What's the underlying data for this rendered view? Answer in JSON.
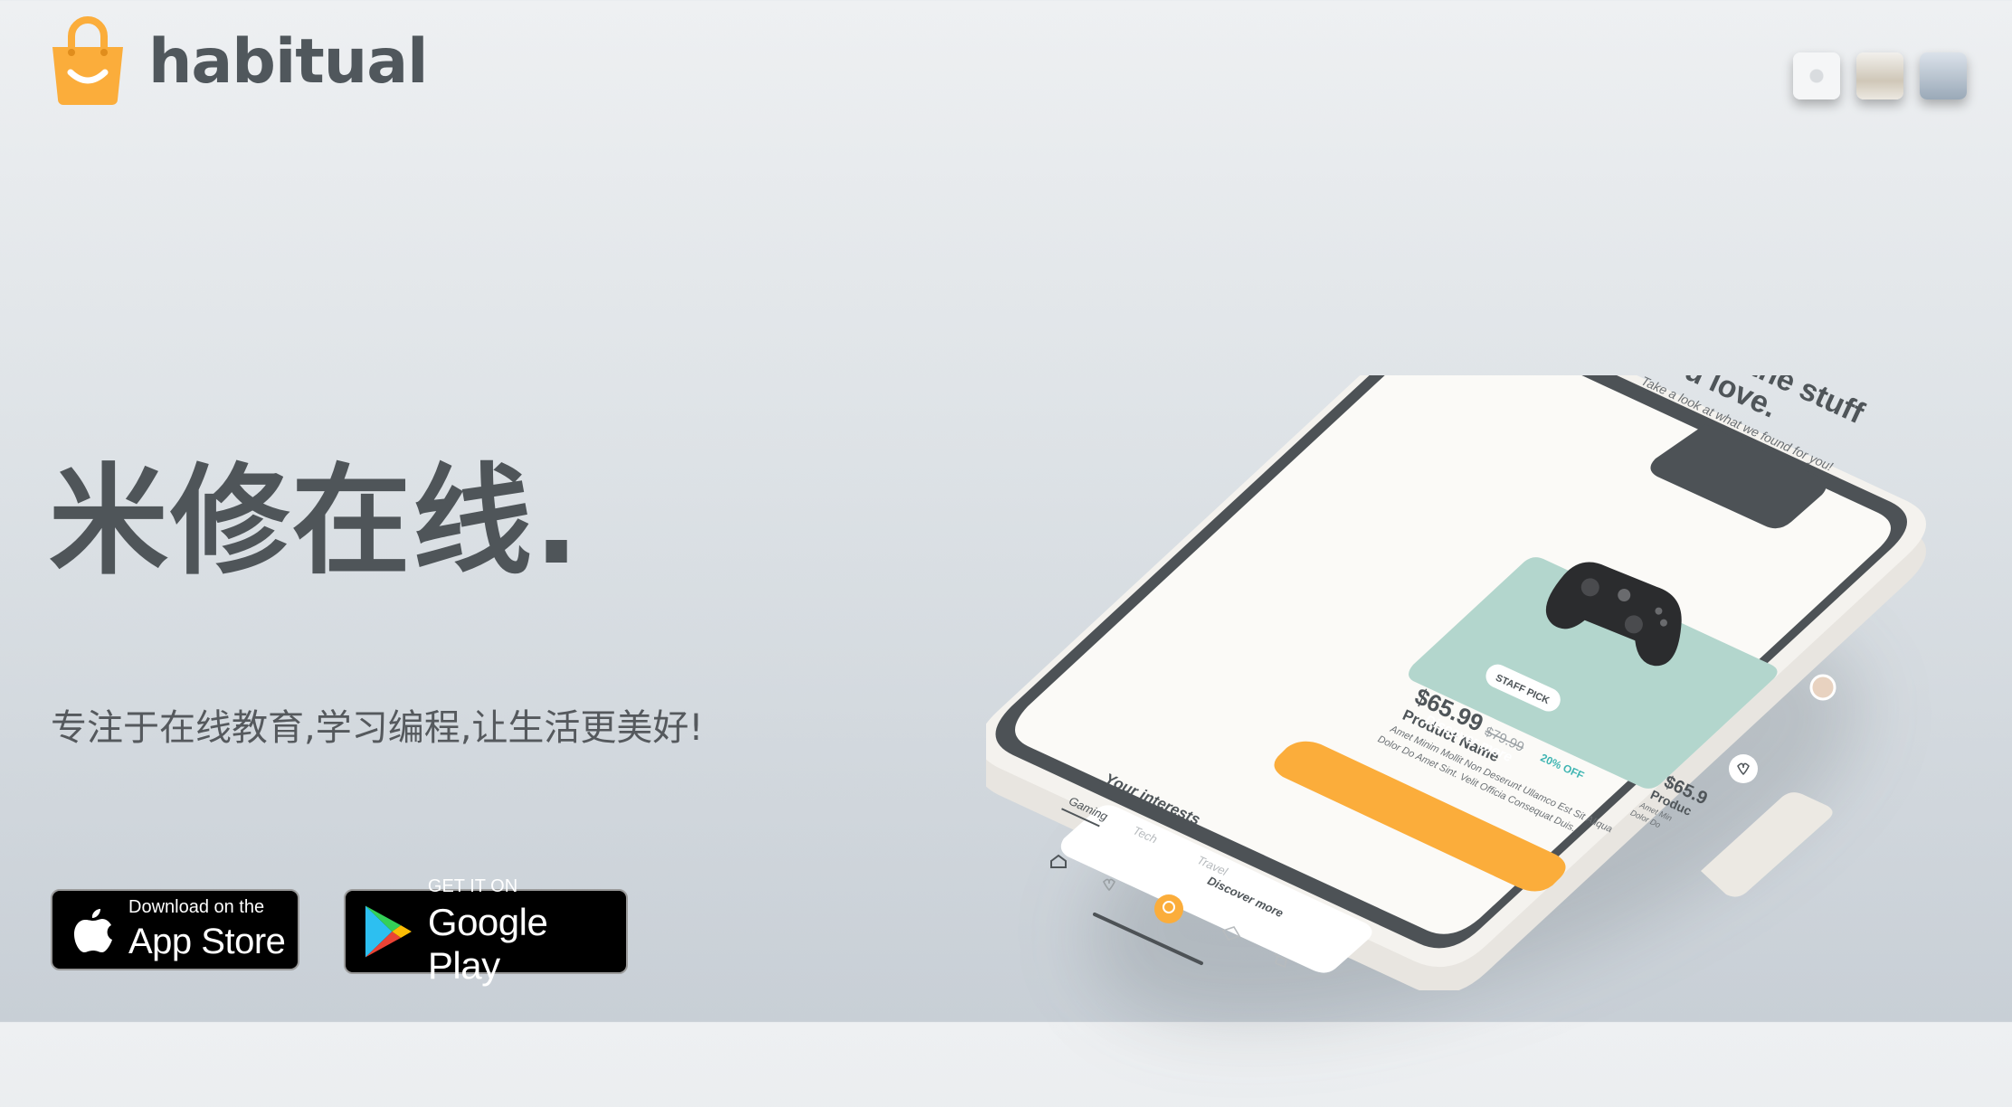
{
  "header": {
    "brand": "habitual",
    "theme_swatches": [
      "light-theme",
      "sand-theme",
      "blue-theme"
    ]
  },
  "hero": {
    "title": "米修在线.",
    "subtitle": "专注于在线教育,学习编程,让生活更美好!"
  },
  "badges": {
    "appstore": {
      "small": "Download on the",
      "big": "App Store"
    },
    "googleplay": {
      "small": "GET IT ON",
      "big": "Google Play"
    }
  },
  "phone": {
    "headline_1": "Find the stuff",
    "headline_2": "you love.",
    "tagline": "Take a look at what we found for you!",
    "card": {
      "badge": "STAFF PICK",
      "price": "$65.99",
      "old_price": "$79.99",
      "discount": "20% OFF",
      "product_name": "Product Name",
      "description_1": "Amet Minim Mollit Non Deserunt Ullamco Est Sit Aliqua",
      "description_2": "Dolor Do Amet Sint. Velit Officia Consequat Duis."
    },
    "cta": "Discover more",
    "next_card": {
      "price": "$65.9",
      "product_name": "Produc",
      "line_1": "Amet Min",
      "line_2": "Dolor Do"
    },
    "interests": {
      "title": "Your interests",
      "more": "Discover more",
      "tabs": [
        "Gaming",
        "Tech",
        "Travel"
      ]
    }
  },
  "colors": {
    "accent": "#fbad3b",
    "text_dark": "#4f5559",
    "card_mint": "#b3d6cd",
    "discount_teal": "#3fb5b2"
  }
}
